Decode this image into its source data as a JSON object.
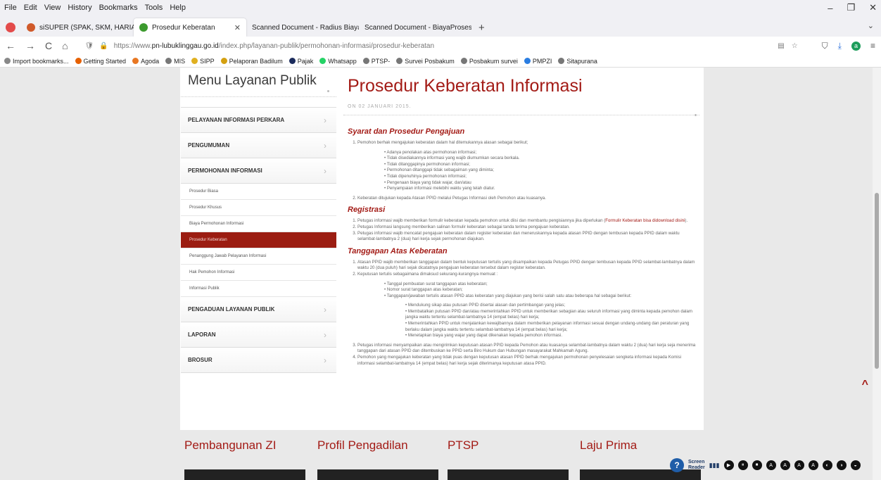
{
  "menubar": {
    "items": [
      "File",
      "Edit",
      "View",
      "History",
      "Bookmarks",
      "Tools",
      "Help"
    ]
  },
  "window": {
    "minimize": "–",
    "restore": "❐",
    "close": "✕"
  },
  "tabs": [
    {
      "label": "siSUPER (SPAK, SKM, HARIAN) | Dire",
      "color": "#d05a2a",
      "active": false
    },
    {
      "label": "Prosedur Keberatan",
      "color": "#3c9a2e",
      "active": true
    },
    {
      "label": "Scanned Document - Radius Biaya.p",
      "color": "",
      "active": false
    },
    {
      "label": "Scanned Document - BiayaProses.p",
      "color": "",
      "active": false
    }
  ],
  "tab_close": "✕",
  "new_tab": "+",
  "tab_list": "⌄",
  "nav": {
    "back": "←",
    "forward": "→",
    "reload": "C",
    "home": "⌂",
    "url_prefix": "https://www.",
    "url_domain": "pn-lubuklinggau.go.id",
    "url_path": "/index.php/layanan-publik/permohonan-informasi/prosedur-keberatan",
    "lock": "🔒",
    "shield": "🛡",
    "reader": "▤",
    "star": "☆",
    "pocket": "⛉",
    "download": "⤓",
    "account": "a",
    "menu": "≡"
  },
  "bookmarks": [
    {
      "label": "Import bookmarks...",
      "color": "#888"
    },
    {
      "label": "Getting Started",
      "color": "#e66000"
    },
    {
      "label": "Agoda",
      "color": "#e87722"
    },
    {
      "label": "MIS",
      "color": "#777"
    },
    {
      "label": "SIPP",
      "color": "#e0b020"
    },
    {
      "label": "Pelaporan Badilum",
      "color": "#d4a010"
    },
    {
      "label": "Pajak",
      "color": "#1b2b5c"
    },
    {
      "label": "Whatsapp",
      "color": "#25d366"
    },
    {
      "label": "PTSP-",
      "color": "#777"
    },
    {
      "label": "Survei Posbakum",
      "color": "#777"
    },
    {
      "label": "Posbakum survei",
      "color": "#777"
    },
    {
      "label": "PMPZI",
      "color": "#2a7de1"
    },
    {
      "label": "Sitapurana",
      "color": "#777"
    }
  ],
  "sidebar": {
    "title": "Menu Layanan Publik",
    "items": [
      {
        "label": "PELAYANAN INFORMASI PERKARA"
      },
      {
        "label": "PENGUMUMAN"
      },
      {
        "label": "PERMOHONAN INFORMASI"
      }
    ],
    "subitems": [
      {
        "label": "Prosedur Biasa",
        "active": false
      },
      {
        "label": "Prosedur Khusus",
        "active": false
      },
      {
        "label": "Biaya Permohonan Informasi",
        "active": false
      },
      {
        "label": "Prosedur Keberatan",
        "active": true
      },
      {
        "label": "Penanggung Jawab Pelayanan Informasi",
        "active": false
      },
      {
        "label": "Hak Pemohon Informasi",
        "active": false
      },
      {
        "label": "Informasi Publik",
        "active": false
      }
    ],
    "items2": [
      {
        "label": "PENGADUAN LAYANAN PUBLIK"
      },
      {
        "label": "LAPORAN"
      },
      {
        "label": "BROSUR"
      }
    ],
    "chevron": "›"
  },
  "article": {
    "title": "Prosedur Keberatan Informasi",
    "date": "ON 02 JANUARI 2015.",
    "s1": {
      "heading": "Syarat dan Prosedur Pengajuan",
      "p1": "Pemohon berhak mengajukan keberatan dalam hal ditemukannya alasan sebagai berikut;",
      "bullets": [
        "Adanya penolakan atas permohonan informasi;",
        "Tidak disediakannya informasi yang wajib diumumkan secara berkala.",
        "Tidak ditanggapinya permohonan informasi;",
        "Permohonan ditanggapi tidak sebagaiman yang diminta;",
        "Tidak dipenuhinya permohonan informasi;",
        "Pengenaan biaya yang tidak wajar, dan/atau",
        "Penyampaian informasi melebihi waktu yang telah diatur."
      ],
      "p2": "Keberatan ditujukan kepada Atasan PPID melalui Petugas Informasi oleh Pemohon atau kuasanya."
    },
    "s2": {
      "heading": "Registrasi",
      "p1": "Petugas informasi wajib memberikan formulir keberatan kepada pemohon untuk diisi dan membantu pengisiannya jika diperlukan (",
      "link": "Formulir Keberatan bisa didownload disini",
      "p1b": ").",
      "p2": "Petugas Informasi langsung memberikan salinan formulir keberatan sebagai tanda terima pengajuan keberatan.",
      "p3": "Petugas informasi wajib mencatat pengajuan keberatan dalam register keberatan dan meneruskannya kepada atasan PPID dengan tembusan kepada PPID dalam waktu selambat-lambatnya 2 (dua) hari kerja sejak permohonan diajukan."
    },
    "s3": {
      "heading": "Tanggapan Atas Keberatan",
      "p1": "Atasan PPID wajib memberikan tanggapan dalam bentuk keputusan tertulis yang disampaikan kepada Petugas PPID dengan tembusan kepada PPID selambat-lambatnya dalam waktu 20 (dua puluh) hari sejak dicatatnya pengajuan keberatan tersebut dalam register keberatan.",
      "p2": "Keputusan tertulis sebagaimana dimaksud sekurang-kurangnya memuat :",
      "bullets": [
        "Tanggal pembuatan surat tanggapan atas keberatan;",
        "Nomor surat tanggapan atas keberatan;",
        "Tanggapan/jawaban tertulis atasan PPID atas keberatan yang diajukan yang berisi salah satu atau beberapa hal sebagai berikut:"
      ],
      "deep": [
        "Mendukung sikap atau putusan PPID disertai alasan dan pertimbangan yang jelas;",
        "Membatalkan putusan PPID dan/atau memerintahkan PPID untuk memberikan sebagian atau seluruh informasi yang diminta kepada pemohon dalam jangka waktu tertentu selambat-lambatnya 14 (empat belas) hari kerja;",
        "Memerintahkan PPID untuk menjalankan kewajibannya dalam memberikan pelayanan informasi sesuai dengan undang-undang dan peraturan yang berlaku dalam jangka waktu tertentu selambat-lambatnya 14 (empat belas) hari kerja;",
        "Menetapkan biaya yang wajar yang dapat dikenakan kepada pemohon informasi."
      ],
      "p3": "Petugas informasi menyampaikan atau mengirimkan keputusan atasan PPID kepada Pemohon atau kuasanya selambat-lambatnya dalam waktu 2 (dua) hari kerja seja menerima tanggapan dari atasan PPID dan ditembuskan ke PPID serta Biro Hukum dan Hubungan masayarakat Mahkamah Agung.",
      "p4": "Pemohon yang mengajukan keberatan yang tidak puas dengan keputusan atasan PPID berhak mengajukan permohonan penyelesaian sengketa informasi kepada Komisi informasi selambat-lambatnya 14 (empat belas) hari kerja sejak diterimanya keputusan atasa PPID."
    }
  },
  "footer": {
    "h1": "Pembangunan ZI",
    "h2": "Profil Pengadilan",
    "h3": "PTSP",
    "h4": "Laju Prima"
  },
  "scroll_top": "^",
  "screen_reader": {
    "l1": "Screen",
    "l2": "Reader",
    "b": [
      "▶",
      "⏸",
      "⏹",
      "A",
      "A",
      "A",
      "A",
      "◐",
      "◑",
      "◒"
    ]
  }
}
